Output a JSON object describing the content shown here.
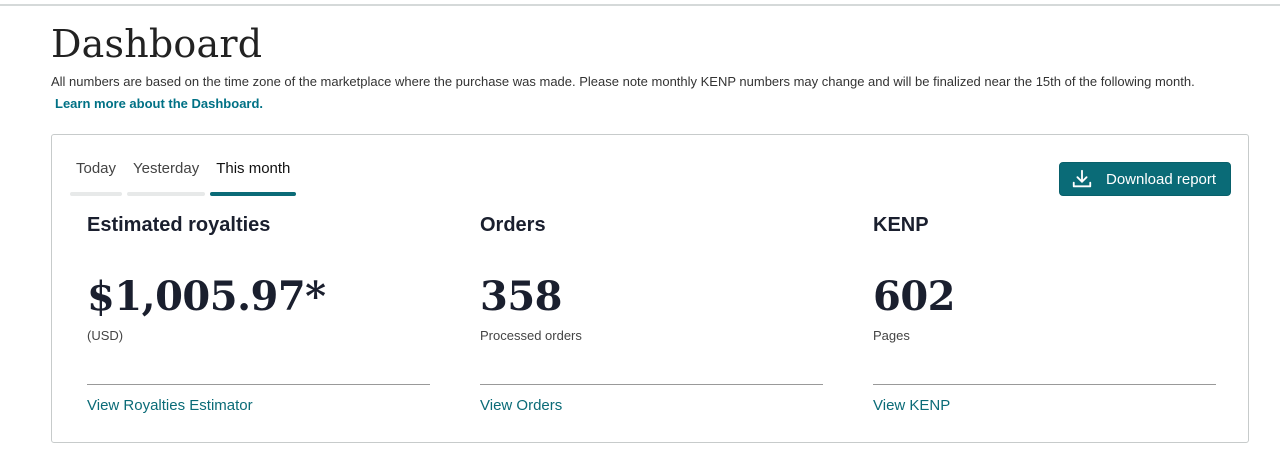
{
  "page": {
    "title": "Dashboard",
    "intro_text": "All numbers are based on the time zone of the marketplace where the purchase was made. Please note monthly KENP numbers may change and will be finalized near the 15th of the following month.",
    "learn_more_label": "Learn more about the Dashboard."
  },
  "tabs": [
    {
      "label": "Today",
      "active": false
    },
    {
      "label": "Yesterday",
      "active": false
    },
    {
      "label": "This month",
      "active": true
    }
  ],
  "download_button": {
    "label": "Download report",
    "icon": "download-icon"
  },
  "metrics": [
    {
      "label": "Estimated royalties",
      "value": "$1,005.97*",
      "sub": "(USD)",
      "link": "View Royalties Estimator"
    },
    {
      "label": "Orders",
      "value": "358",
      "sub": "Processed orders",
      "link": "View Orders"
    },
    {
      "label": "KENP",
      "value": "602",
      "sub": "Pages",
      "link": "View KENP"
    }
  ],
  "colors": {
    "accent": "#0a6b77",
    "text": "#1a1f2e",
    "border": "#c7cbcb"
  }
}
